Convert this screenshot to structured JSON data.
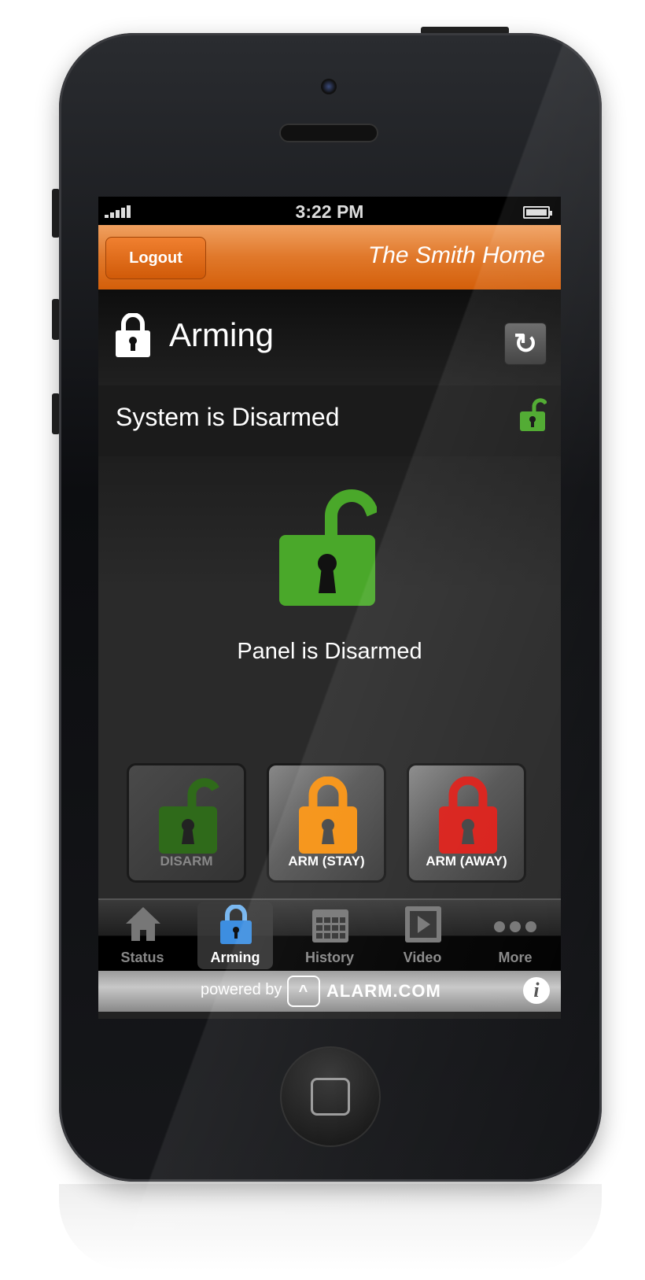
{
  "status_bar": {
    "time": "3:22 PM"
  },
  "header": {
    "logout_label": "Logout",
    "home_name": "The Smith Home"
  },
  "section": {
    "title": "Arming",
    "refresh_icon": "refresh-icon"
  },
  "system": {
    "status_text": "System is Disarmed",
    "panel_text": "Panel is Disarmed"
  },
  "arm_buttons": [
    {
      "label": "DISARM",
      "color": "#2f6a1a",
      "state": "current"
    },
    {
      "label": "ARM (STAY)",
      "color": "#f5900f"
    },
    {
      "label": "ARM (AWAY)",
      "color": "#d9201a"
    }
  ],
  "tabs": [
    {
      "label": "Status",
      "icon": "home-icon"
    },
    {
      "label": "Arming",
      "icon": "lock-icon",
      "active": true
    },
    {
      "label": "History",
      "icon": "calendar-icon"
    },
    {
      "label": "Video",
      "icon": "play-icon"
    },
    {
      "label": "More",
      "icon": "more-icon"
    }
  ],
  "footer": {
    "powered_by": "powered by",
    "brand": "ALARM.COM",
    "info_label": "i"
  },
  "colors": {
    "accent": "#e0782a",
    "disarmed_green": "#4aa82a"
  }
}
